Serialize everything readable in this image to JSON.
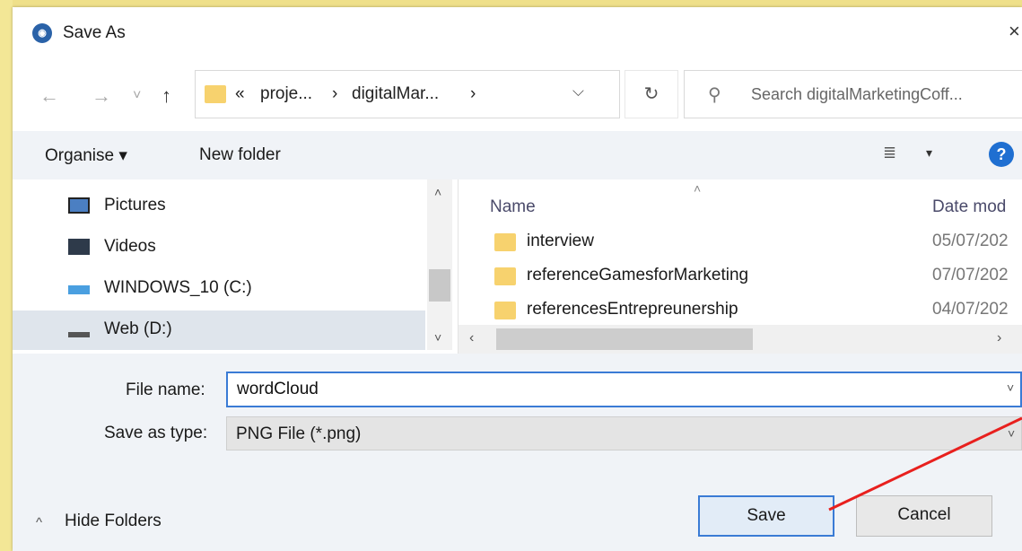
{
  "dialog": {
    "title": "Save As",
    "close_icon": "close-icon",
    "icon": "app-icon"
  },
  "navigation": {
    "back": "←",
    "forward": "→",
    "recent": "˅",
    "up": "↑",
    "breadcrumb": [
      "«",
      "proje...",
      "›",
      "digitalMar...",
      "›"
    ],
    "address_dropdown": "⌵",
    "refresh": "↻",
    "search_placeholder": "Search digitalMarketingCoff..."
  },
  "toolbar": {
    "organise": "Organise ▾",
    "new_folder": "New folder",
    "view_icon": "≣",
    "view_drop": "▾",
    "help": "?"
  },
  "nav_pane": {
    "items": [
      {
        "label": "Pictures",
        "icon": "pictures-icon"
      },
      {
        "label": "Videos",
        "icon": "videos-icon"
      },
      {
        "label": "WINDOWS_10 (C:)",
        "icon": "windows-drive-icon"
      },
      {
        "label": "Web (D:)",
        "icon": "drive-icon",
        "selected": true
      }
    ]
  },
  "file_list": {
    "columns": {
      "name": "Name",
      "date": "Date mod"
    },
    "rows": [
      {
        "name": "interview",
        "date": "05/07/202"
      },
      {
        "name": "referenceGamesforMarketing",
        "date": "07/07/202"
      },
      {
        "name": "referencesEntrepreunership",
        "date": "04/07/202"
      }
    ]
  },
  "form": {
    "file_name_label": "File name:",
    "file_name_value": "wordCloud",
    "save_type_label": "Save as type:",
    "save_type_value": "PNG File (*.png)",
    "hide_folders": "Hide Folders",
    "save_label": "Save",
    "cancel_label": "Cancel"
  },
  "colors": {
    "accent": "#3a7bd5",
    "annotation_arrow": "#e8201e",
    "background_page": "#f5e58c"
  }
}
